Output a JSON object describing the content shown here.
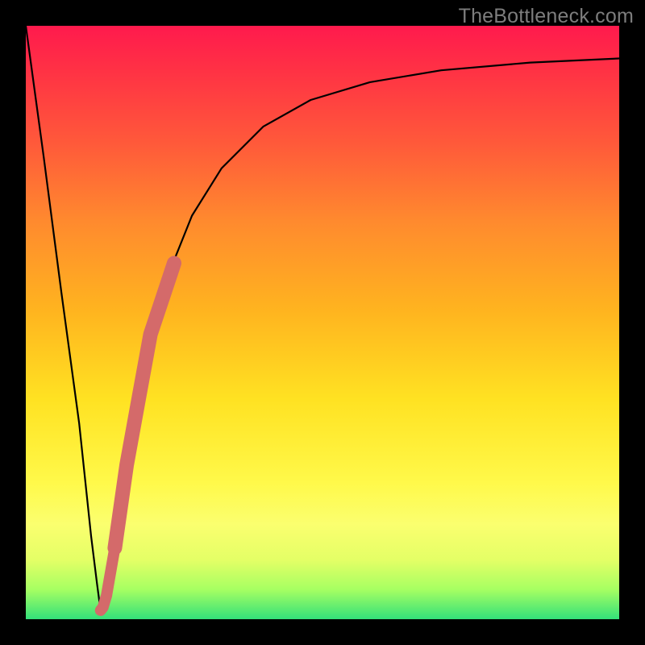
{
  "watermark": "TheBottleneck.com",
  "colors": {
    "frame": "#000000",
    "curve_stroke": "#000000",
    "highlight_stroke": "#d46a6a",
    "gradient_top": "#ff1a4d",
    "gradient_bottom": "#33e07a"
  },
  "chart_data": {
    "type": "line",
    "title": "",
    "xlabel": "",
    "ylabel": "",
    "xlim": [
      0,
      100
    ],
    "ylim": [
      0,
      100
    ],
    "grid": false,
    "series": [
      {
        "name": "bottleneck-curve",
        "x": [
          0,
          3,
          6,
          9,
          11,
          12,
          12.6,
          13.2,
          14,
          16,
          18,
          21,
          24,
          28,
          33,
          40,
          48,
          58,
          70,
          85,
          100
        ],
        "y": [
          100,
          78,
          55,
          33,
          14,
          6,
          1.5,
          3,
          8,
          22,
          35,
          48,
          58,
          68,
          76,
          83,
          87.5,
          90.5,
          92.5,
          93.8,
          94.5
        ]
      },
      {
        "name": "highlight-segment",
        "x": [
          12.6,
          13.0,
          13.6,
          15.0,
          17.0,
          19.0,
          21.0,
          23.0,
          25.0
        ],
        "y": [
          1.5,
          2.0,
          4.0,
          12.0,
          26.0,
          37.0,
          48.0,
          54.0,
          60.0
        ]
      }
    ],
    "annotations": []
  }
}
